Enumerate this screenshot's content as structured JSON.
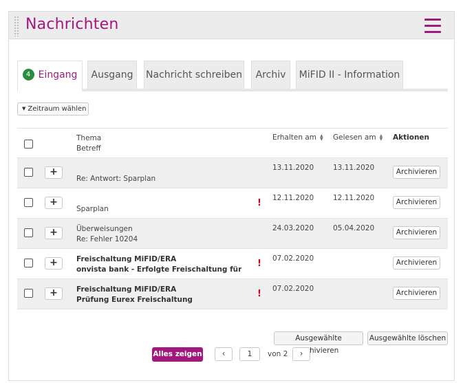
{
  "header": {
    "title": "Nachrichten"
  },
  "tabs": [
    {
      "label": "Eingang",
      "badge": "4",
      "active": true
    },
    {
      "label": "Ausgang"
    },
    {
      "label": "Nachricht schreiben"
    },
    {
      "label": "Archiv"
    },
    {
      "label": "MiFID II - Information"
    }
  ],
  "filter": {
    "label": "Zeitraum wählen"
  },
  "table": {
    "columns": {
      "thema": "Thema",
      "betreff": "Betreff",
      "erhalten": "Erhalten am",
      "gelesen": "Gelesen am",
      "aktionen": "Aktionen"
    },
    "rows": [
      {
        "thema": "",
        "betreff": "Re: Antwort: Sparplan",
        "important": false,
        "erhalten": "13.11.2020",
        "gelesen": "13.11.2020",
        "action": "Archivieren",
        "unread": false
      },
      {
        "thema": "",
        "betreff": "Sparplan",
        "important": true,
        "important_mark": "!",
        "erhalten": "12.11.2020",
        "gelesen": "12.11.2020",
        "action": "Archivieren",
        "unread": false
      },
      {
        "thema": "Überweisungen",
        "betreff": "Re: Fehler 10204",
        "important": false,
        "erhalten": "24.03.2020",
        "gelesen": "05.04.2020",
        "action": "Archivieren",
        "unread": false
      },
      {
        "thema": "Freischaltung MiFID/ERA",
        "betreff": "onvista bank - Erfolgte Freischaltung für ein...",
        "important": true,
        "important_mark": "!",
        "erhalten": "07.02.2020",
        "gelesen": "",
        "action": "Archivieren",
        "unread": true
      },
      {
        "thema": "Freischaltung MiFID/ERA",
        "betreff": "Prüfung Eurex Freischaltung",
        "important": true,
        "important_mark": "!",
        "erhalten": "07.02.2020",
        "gelesen": "",
        "action": "Archivieren",
        "unread": true
      }
    ],
    "expand_label": "+"
  },
  "bulk": {
    "archive_label": "Ausgewählte archivieren",
    "delete_label": "Ausgewählte löschen"
  },
  "pagination": {
    "show_all_label": "Alles zeigen",
    "prev": "‹",
    "next": "›",
    "current_page": "1",
    "of_label": "von 2"
  },
  "colors": {
    "accent": "#a2197e",
    "badge": "#2a8c3f",
    "important": "#d0021b"
  }
}
